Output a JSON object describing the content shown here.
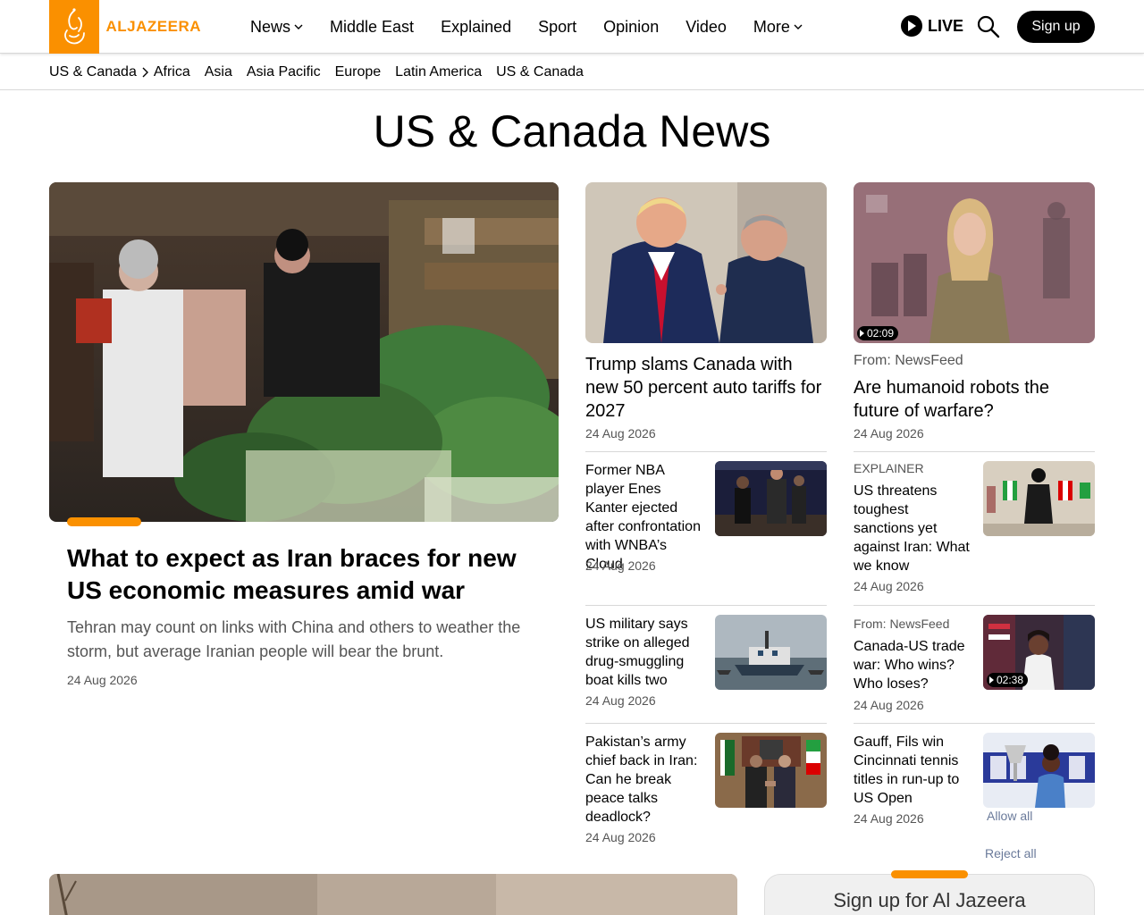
{
  "header": {
    "logo_text": "ALJAZEERA",
    "nav": [
      {
        "label": "News",
        "dropdown": true
      },
      {
        "label": "Middle East",
        "dropdown": false
      },
      {
        "label": "Explained",
        "dropdown": false
      },
      {
        "label": "Sport",
        "dropdown": false
      },
      {
        "label": "Opinion",
        "dropdown": false
      },
      {
        "label": "Video",
        "dropdown": false
      },
      {
        "label": "More",
        "dropdown": true
      }
    ],
    "live_label": "LIVE",
    "signup_label": "Sign up"
  },
  "subnav": {
    "current": "US & Canada",
    "items": [
      "Africa",
      "Asia",
      "Asia Pacific",
      "Europe",
      "Latin America",
      "US & Canada"
    ]
  },
  "page_title": "US & Canada News",
  "feature": {
    "title": "What to expect as Iran braces for new US economic measures amid war",
    "summary": "Tehran may count on links with China and others to weather the storm, but average Iranian people will bear the brunt.",
    "date": "24 Aug 2026"
  },
  "col2": {
    "top": {
      "title": "Trump slams Canada with new 50 percent auto tariffs for 2027",
      "date": "24 Aug 2026"
    },
    "items": [
      {
        "title": "Former NBA player Enes Kanter ejected after confrontation with WNBA’s Cloud",
        "date": "24 Aug 2026"
      },
      {
        "title": "US military says strike on alleged drug-smuggling boat kills two",
        "date": "24 Aug 2026"
      },
      {
        "title": "Pakistan’s army chief back in Iran: Can he break peace talks deadlock?",
        "date": "24 Aug 2026"
      }
    ]
  },
  "col3": {
    "top": {
      "from": "From: NewsFeed",
      "title": "Are humanoid robots the future of warfare?",
      "date": "24 Aug 2026",
      "duration": "02:09"
    },
    "items": [
      {
        "kicker": "EXPLAINER",
        "title": "US threatens toughest sanctions yet against Iran: What we know",
        "date": "24 Aug 2026"
      },
      {
        "kicker": "From: NewsFeed",
        "title": "Canada-US trade war: Who wins? Who loses?",
        "date": "24 Aug 2026",
        "duration": "02:38"
      },
      {
        "title": "Gauff, Fils win Cincinnati tennis titles in run-up to US Open",
        "date": "24 Aug 2026"
      }
    ]
  },
  "cookie": {
    "allow_all": "Allow all",
    "reject_all": "Reject all"
  },
  "newsletter": {
    "title": "Sign up for Al Jazeera"
  },
  "colors": {
    "brand": "#fa9000",
    "text_muted": "#555555",
    "divider": "#d8d8d8"
  }
}
